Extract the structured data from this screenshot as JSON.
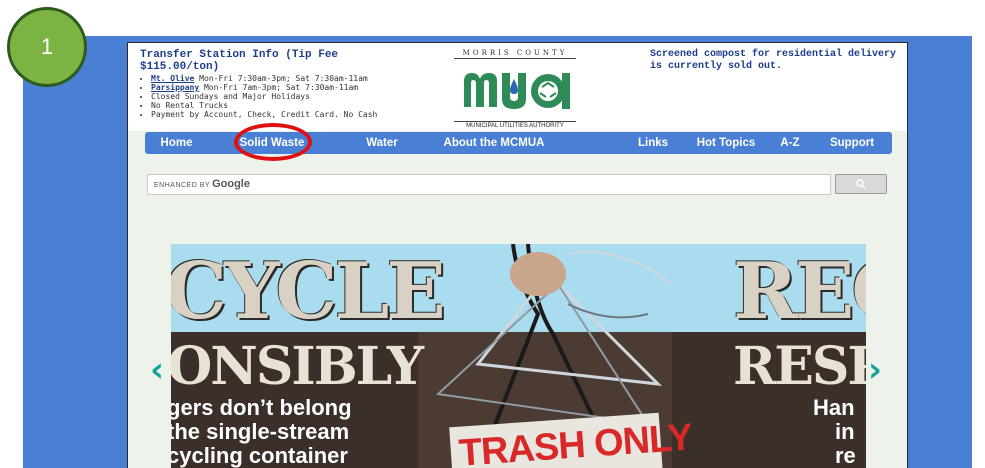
{
  "step": {
    "number": "1"
  },
  "header": {
    "transfer": {
      "title": "Transfer Station Info (Tip Fee $115.00/ton)",
      "items": [
        {
          "link": "Mt. Olive",
          "text": " Mon-Fri 7:30am-3pm; Sat 7:30am-11am"
        },
        {
          "link": "Parsippany",
          "text": " Mon-Fri 7am-3pm; Sat 7:30am-11am"
        },
        {
          "text": "Closed Sundays and Major Holidays"
        },
        {
          "text": "No Rental Trucks"
        },
        {
          "text": "Payment by Account, Check, Credit Card. No Cash"
        }
      ]
    },
    "logo": {
      "top": "MORRIS COUNTY",
      "main": "mua",
      "bottom": "MUNICIPAL UTILITIES AUTHORITY",
      "colors": {
        "green": "#2e8b57",
        "blue": "#2a66b0"
      }
    },
    "notice": "Screened compost for residential delivery is currently sold out."
  },
  "nav": {
    "items": [
      "Home",
      "Solid Waste",
      "Water",
      "About the MCMUA",
      "Links",
      "Hot Topics",
      "A-Z",
      "Support"
    ],
    "highlighted": "Solid Waste",
    "highlight_color": "#e01010"
  },
  "search": {
    "enhanced_label": "ENHANCED BY",
    "brand": "Google",
    "button_icon": "search-icon"
  },
  "banner": {
    "left_big": "CYCLE",
    "left_mid": "ONSIBLY",
    "left_lines": [
      "gers don’t belong",
      "the single-stream",
      "cycling container"
    ],
    "right_big": "REC",
    "right_mid": "RESP",
    "right_lines": [
      "Han",
      "in",
      "re"
    ],
    "sign": "TRASH ONLY",
    "prev_icon": "chevron-left-icon",
    "next_icon": "chevron-right-icon"
  }
}
